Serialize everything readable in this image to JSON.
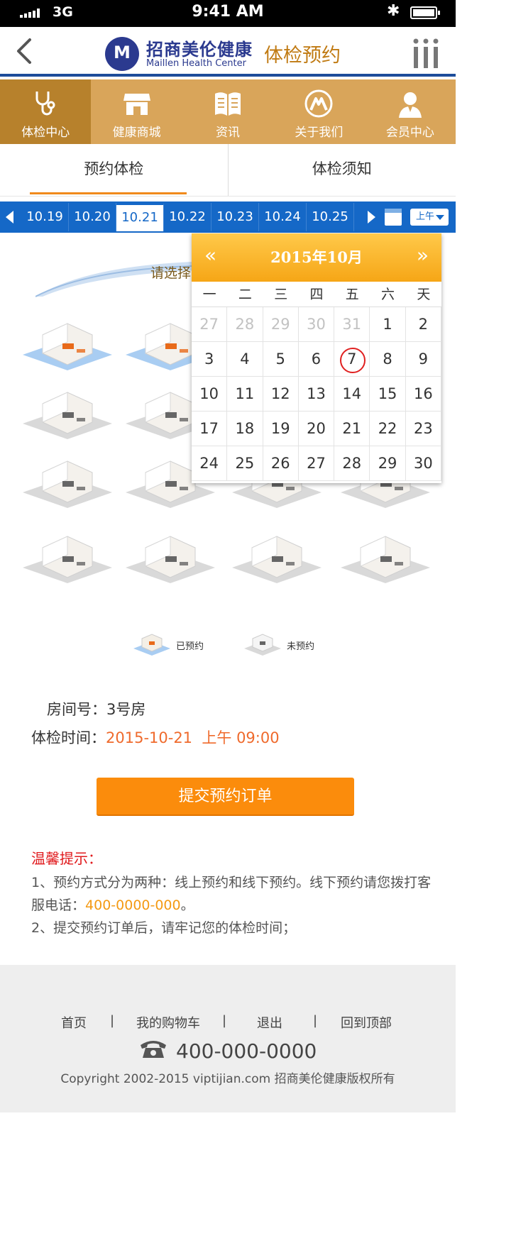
{
  "status_bar": {
    "carrier": "3G",
    "time": "9:41 AM"
  },
  "header": {
    "brand_cn": "招商美伦健康",
    "brand_en": "Maillen Health Center",
    "title": "体检预约"
  },
  "nav": [
    {
      "label": "体检中心",
      "icon": "stethoscope-icon"
    },
    {
      "label": "健康商城",
      "icon": "store-icon"
    },
    {
      "label": "资讯",
      "icon": "book-icon"
    },
    {
      "label": "关于我们",
      "icon": "brand-logo-icon"
    },
    {
      "label": "会员中心",
      "icon": "user-icon"
    }
  ],
  "tabs": [
    "预约体检",
    "体检须知"
  ],
  "date_bar": {
    "dates": [
      "10.19",
      "10.20",
      "10.21",
      "10.22",
      "10.23",
      "10.24",
      "10.25"
    ],
    "selected": "10.21",
    "period": "上午"
  },
  "rooms": {
    "banner_text": "请选择",
    "booked_color": "#a9cdf2",
    "free_color": "#d9d9d9"
  },
  "legend": {
    "booked": "已预约",
    "free": "未预约"
  },
  "calendar": {
    "title": "2015年10月",
    "prev": "«",
    "next": "»",
    "weekdays": [
      "一",
      "二",
      "三",
      "四",
      "五",
      "六",
      "天"
    ],
    "days": [
      "27",
      "28",
      "29",
      "30",
      "31",
      "1",
      "2",
      "3",
      "4",
      "5",
      "6",
      "7",
      "8",
      "9",
      "10",
      "11",
      "12",
      "13",
      "14",
      "15",
      "16",
      "17",
      "18",
      "19",
      "20",
      "21",
      "22",
      "23",
      "24",
      "25",
      "26",
      "27",
      "28",
      "29",
      "30"
    ],
    "marked": "7"
  },
  "booking": {
    "room_label": "房间号：",
    "room_value": "3号房",
    "time_label": "体检时间：",
    "time_value": "2015-10-21  上午 09:00"
  },
  "submit_label": "提交预约订单",
  "tips": {
    "title": "温馨提示：",
    "line1_prefix": "1、预约方式分为两种：线上预约和线下预约。线下预约请您拨打客服电话：",
    "line1_phone": "400-0000-000",
    "line1_suffix": "。",
    "line2": "2、提交预约订单后，请牢记您的体检时间；"
  },
  "footer": {
    "links": [
      "首页",
      "我的购物车",
      "退出",
      "回到顶部"
    ],
    "separator": "|",
    "phone": "400-000-0000",
    "copyright": "Copyright 2002-2015 viptijian.com  招商美伦健康版权所有"
  }
}
